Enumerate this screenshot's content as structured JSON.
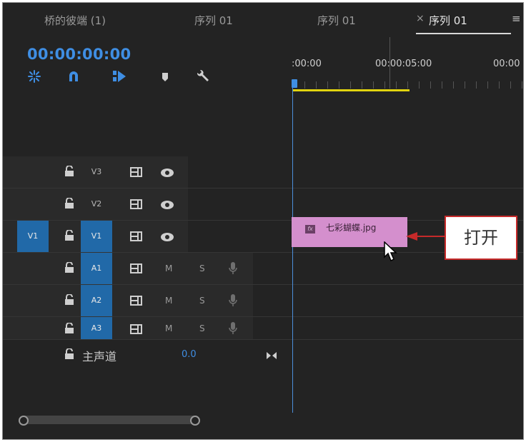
{
  "tabs": [
    {
      "label": "桥的彼端 (1)",
      "active": false
    },
    {
      "label": "序列 01",
      "active": false
    },
    {
      "label": "序列 01",
      "active": false
    },
    {
      "label": "序列 01",
      "active": true
    }
  ],
  "tab_close": "×",
  "tab_menu": "≡",
  "timecode": "00:00:00:00",
  "tools": [
    "snap-icon",
    "magnet-icon",
    "linked-selection-icon",
    "marker-icon",
    "wrench-icon"
  ],
  "ruler": {
    "labels": [
      ":00:00",
      "00:00:05:00",
      "00:00"
    ]
  },
  "tracks": [
    {
      "name": "V3",
      "type": "video",
      "source_patch": "",
      "targeted": false
    },
    {
      "name": "V2",
      "type": "video",
      "source_patch": "",
      "targeted": false
    },
    {
      "name": "V1",
      "type": "video",
      "source_patch": "V1",
      "targeted": true
    },
    {
      "name": "A1",
      "type": "audio",
      "source_patch": "",
      "targeted": true
    },
    {
      "name": "A2",
      "type": "audio",
      "source_patch": "",
      "targeted": true
    },
    {
      "name": "A3",
      "type": "audio",
      "source_patch": "",
      "targeted": true
    }
  ],
  "audio_buttons": {
    "mute": "M",
    "solo": "S"
  },
  "master": {
    "label": "主声道",
    "value": "0.0"
  },
  "clip": {
    "fx": "fx",
    "name": "七彩蝴蝶.jpg"
  },
  "callout": {
    "text": "打开"
  },
  "colors": {
    "accent": "#3f8ee3",
    "clip": "#d48fcd",
    "callout_border": "#c62a2a",
    "work_bar": "#e1d30f"
  }
}
